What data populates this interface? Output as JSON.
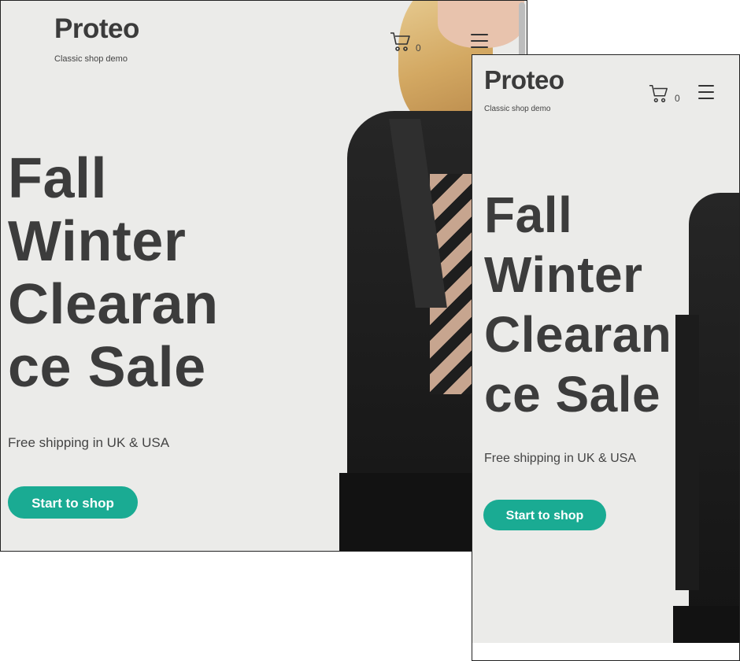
{
  "shop": {
    "logo": "Proteo",
    "tagline": "Classic shop demo",
    "cart_count": "0"
  },
  "hero": {
    "headline_lines": [
      "Fall",
      "Winter",
      "Clearan",
      "ce Sale"
    ],
    "subtitle": "Free shipping in UK & USA",
    "cta_label": "Start to shop"
  },
  "colors": {
    "accent": "#1aab93",
    "text": "#3c3c3c",
    "background": "#ebebe9"
  },
  "icons": {
    "cart": "shopping-cart-icon",
    "menu": "hamburger-menu-icon"
  }
}
